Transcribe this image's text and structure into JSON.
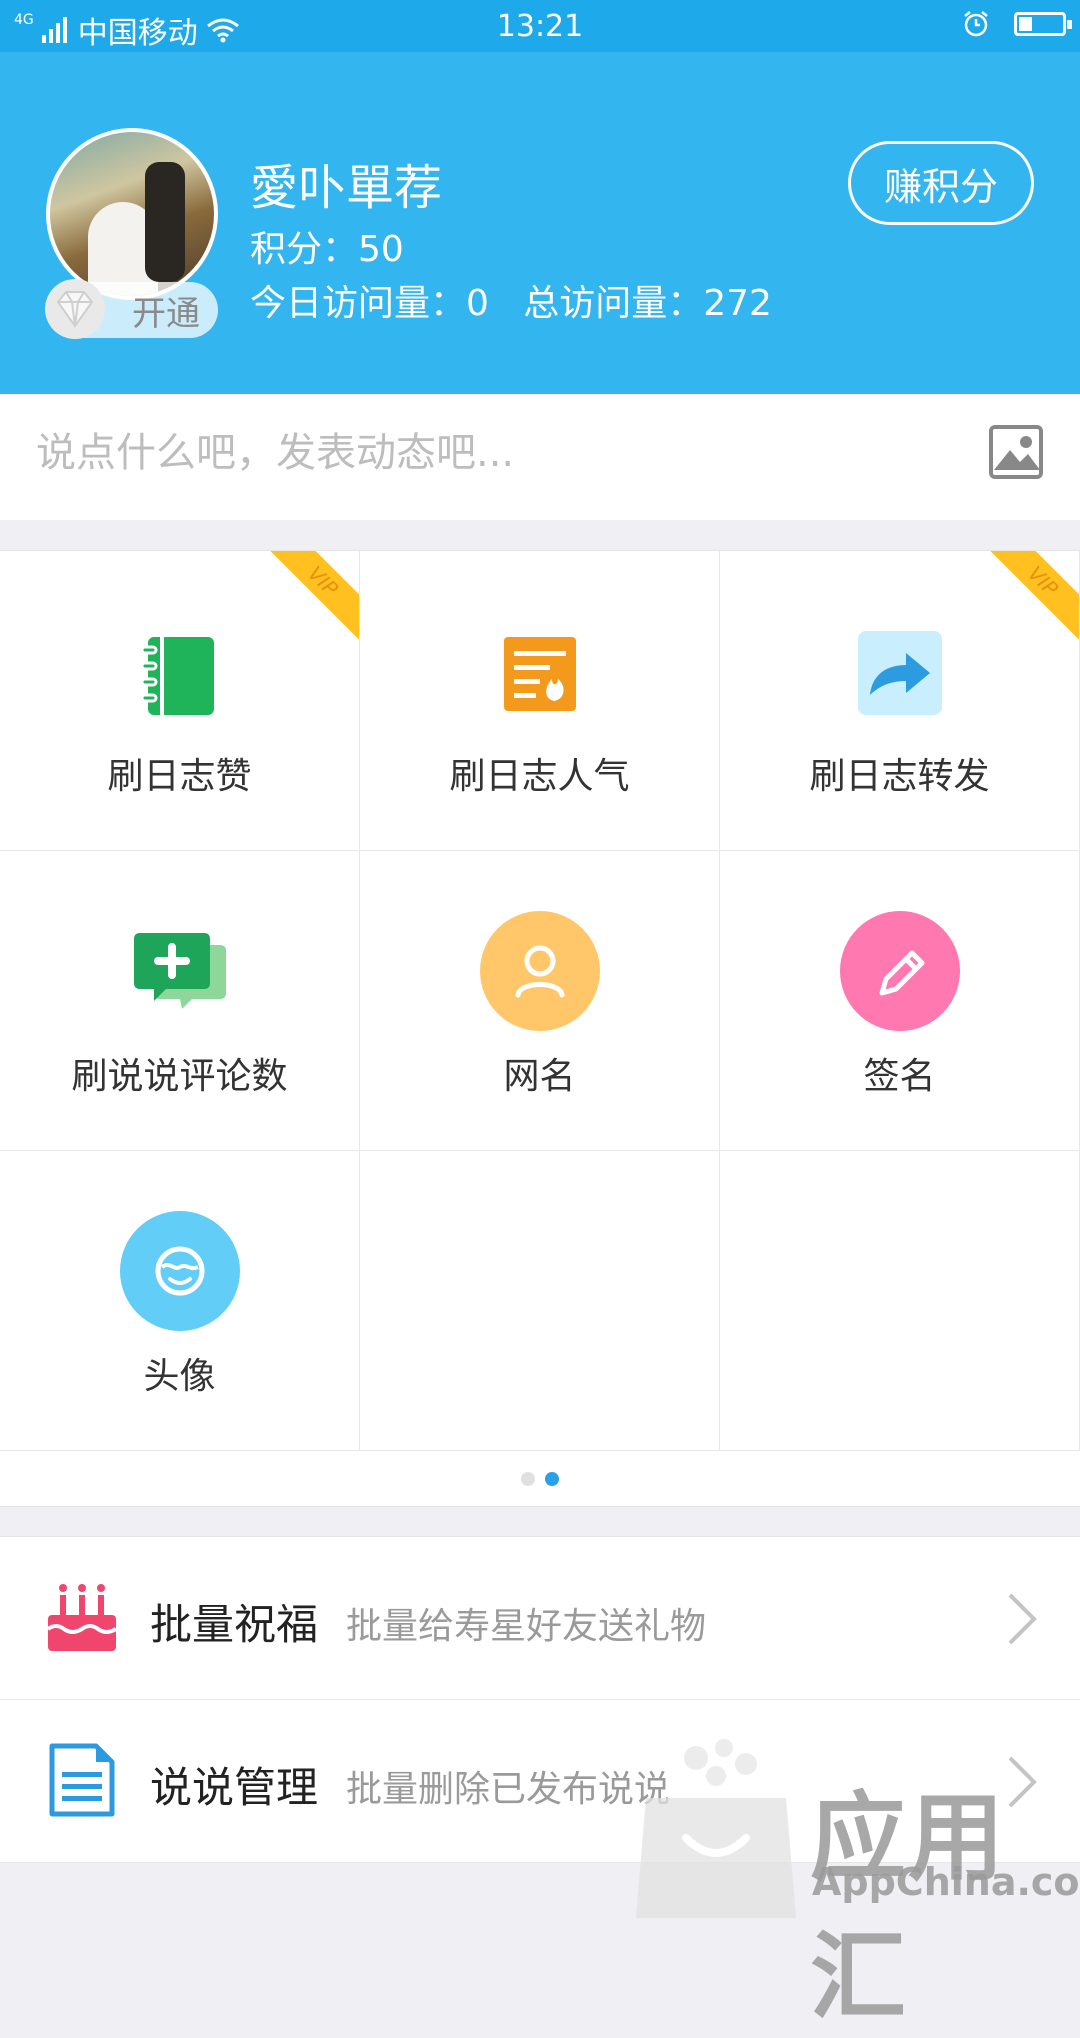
{
  "status_bar": {
    "network_gen": "4G",
    "carrier": "中国移动",
    "time": "13:21",
    "battery_level": 0.3
  },
  "profile": {
    "username": "愛卟單荐",
    "points_text": "积分：50",
    "visits_text": "今日访问量：0   总访问量：272",
    "open_badge": "开通",
    "earn_points_button": "赚积分"
  },
  "post": {
    "placeholder": "说点什么吧，发表动态吧..."
  },
  "grid": {
    "items": [
      {
        "label": "刷日志赞",
        "icon": "notebook-icon",
        "vip": true
      },
      {
        "label": "刷日志人气",
        "icon": "hot-document-icon",
        "vip": false
      },
      {
        "label": "刷日志转发",
        "icon": "share-arrow-icon",
        "vip": true
      },
      {
        "label": "刷说说评论数",
        "icon": "comment-plus-icon",
        "vip": false
      },
      {
        "label": "网名",
        "icon": "user-icon",
        "vip": false
      },
      {
        "label": "签名",
        "icon": "pencil-icon",
        "vip": false
      },
      {
        "label": "头像",
        "icon": "face-icon",
        "vip": false
      }
    ],
    "vip_label": "VIP",
    "page_indicator": {
      "pages": 2,
      "active": 2
    }
  },
  "list": {
    "items": [
      {
        "title": "批量祝福",
        "subtitle": "批量给寿星好友送礼物",
        "icon": "birthday-cake-icon"
      },
      {
        "title": "说说管理",
        "subtitle": "批量删除已发布说说",
        "icon": "document-icon"
      }
    ]
  },
  "watermark": {
    "text": "应用汇",
    "english": "AppChina.com"
  },
  "colors": {
    "header_blue": "#33b5f0",
    "status_blue": "#1ea9ea",
    "vip_yellow": "#ffc020"
  }
}
